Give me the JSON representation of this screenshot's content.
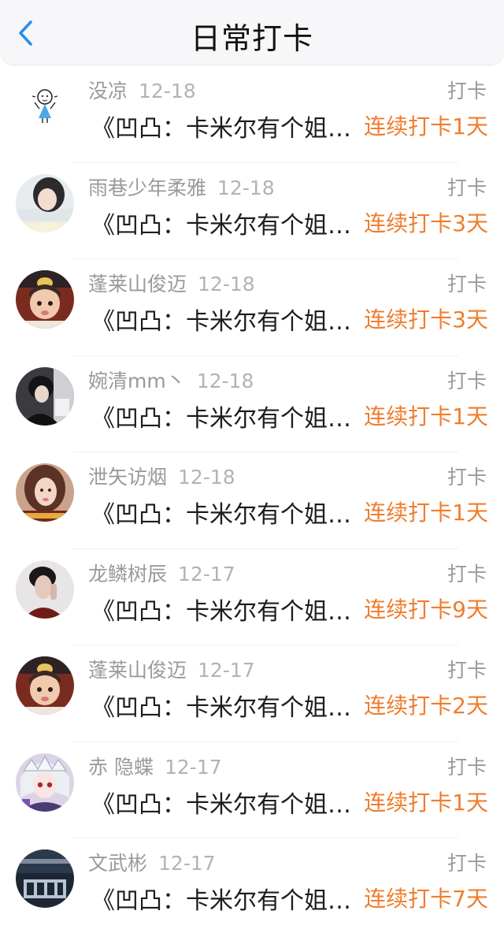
{
  "header": {
    "title": "日常打卡"
  },
  "items": [
    {
      "name": "没凉",
      "date": "12-18",
      "action": "打卡",
      "content": "《凹凸：卡米尔有个姐…",
      "streak": "连续打卡1天"
    },
    {
      "name": "雨巷少年柔雅",
      "date": "12-18",
      "action": "打卡",
      "content": "《凹凸：卡米尔有个姐…",
      "streak": "连续打卡3天"
    },
    {
      "name": "蓬莱山俊迈",
      "date": "12-18",
      "action": "打卡",
      "content": "《凹凸：卡米尔有个姐…",
      "streak": "连续打卡3天"
    },
    {
      "name": "婉清mm丶",
      "date": "12-18",
      "action": "打卡",
      "content": "《凹凸：卡米尔有个姐…",
      "streak": "连续打卡1天"
    },
    {
      "name": "泄矢访烟",
      "date": "12-18",
      "action": "打卡",
      "content": "《凹凸：卡米尔有个姐…",
      "streak": "连续打卡1天"
    },
    {
      "name": "龙鳞树辰",
      "date": "12-17",
      "action": "打卡",
      "content": "《凹凸：卡米尔有个姐…",
      "streak": "连续打卡9天"
    },
    {
      "name": "蓬莱山俊迈",
      "date": "12-17",
      "action": "打卡",
      "content": "《凹凸：卡米尔有个姐…",
      "streak": "连续打卡2天"
    },
    {
      "name": "赤 隐蝶",
      "date": "12-17",
      "action": "打卡",
      "content": "《凹凸：卡米尔有个姐…",
      "streak": "连续打卡1天"
    },
    {
      "name": "文武彬",
      "date": "12-17",
      "action": "打卡",
      "content": "《凹凸：卡米尔有个姐…",
      "streak": "连续打卡7天"
    }
  ],
  "colors": {
    "accent_blue": "#2d8cf0",
    "streak_orange": "#f07d2e"
  },
  "icons": {
    "back": "chevron-left-icon"
  }
}
